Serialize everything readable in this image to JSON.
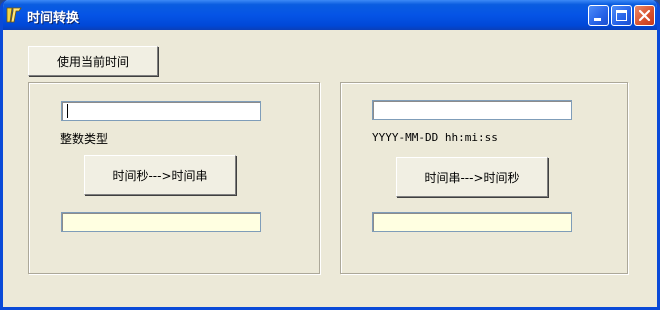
{
  "window": {
    "title": "时间转换",
    "icon": "app-logo-icon"
  },
  "titlebar_buttons": {
    "minimize_icon": "minimize-icon",
    "maximize_icon": "maximize-icon",
    "close_icon": "close-icon"
  },
  "toolbar": {
    "use_current_time_label": "使用当前时间"
  },
  "left_panel": {
    "input_value": "",
    "type_label": "整数类型",
    "convert_button_label": "时间秒--->时间串",
    "output_value": ""
  },
  "right_panel": {
    "input_value": "",
    "format_label": "YYYY-MM-DD hh:mi:ss",
    "convert_button_label": "时间串--->时间秒",
    "output_value": ""
  },
  "colors": {
    "titlebar": "#0554e6",
    "window_bg": "#ece9d8",
    "output_bg": "#ffffe1",
    "close_button": "#d9542f"
  }
}
